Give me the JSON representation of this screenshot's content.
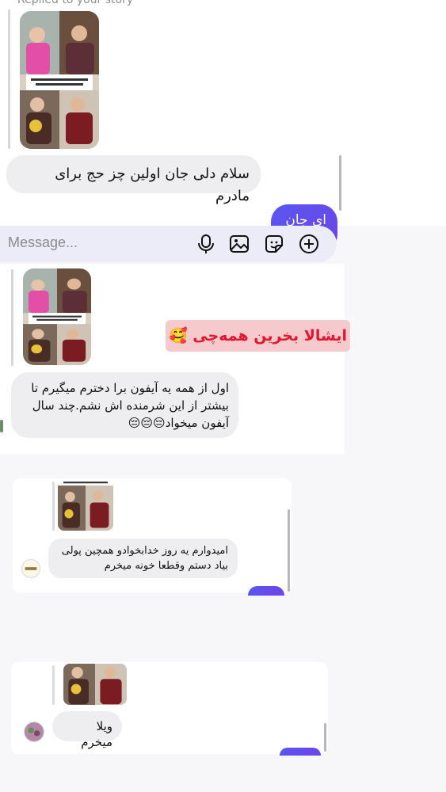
{
  "story_reply": {
    "caption": "Replied to your story"
  },
  "messages": {
    "m1": "سلام دلی جان اولین چز حج برای مادرم",
    "m1_reply_partial": "ای جان",
    "m2": "اول از همه یه آیفون برا دخترم میگیرم تا بیشتر از این شرمنده اش نشم.چند سال آیفون میخواد😔😔😔",
    "m3": "امیدوارم یه روز خدابخوادو همچین پولی بیاد دستم وقطعا خونه میخرم",
    "m4": "ویلا میخرم"
  },
  "sticker": {
    "text": "ایشالا بخرین همه‌چی 🥰"
  },
  "composer": {
    "placeholder": "Message...",
    "icons": [
      "microphone-icon",
      "gallery-icon",
      "sticker-icon",
      "add-icon"
    ]
  },
  "colors": {
    "outgoing_bubble": "#5a56f0",
    "incoming_bubble": "#eeeef1",
    "sticker_bg": "#f6c9cd",
    "sticker_text": "#e2162d",
    "composer_bg": "#ecebf8"
  }
}
